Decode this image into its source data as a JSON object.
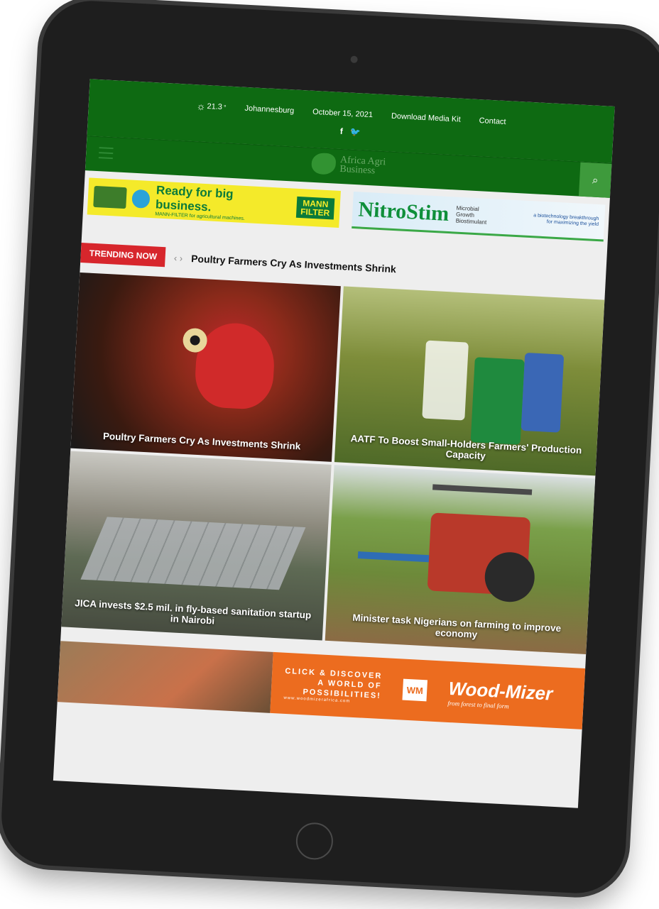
{
  "topbar": {
    "temperature": "21.3",
    "degree": "°",
    "city": "Johannesburg",
    "date": "October 15, 2021",
    "download_link": "Download Media Kit",
    "contact_link": "Contact",
    "social": {
      "facebook": "f",
      "twitter": "🐦"
    }
  },
  "logo": {
    "line1": "Africa Agri",
    "line2": "Business"
  },
  "ads": {
    "mann": {
      "headline": "Ready for big business.",
      "sub": "MANN-FILTER for agricultural machines.",
      "brand_top": "MANN",
      "brand_bottom": "FILTER"
    },
    "nitro": {
      "brand": "NitroStim",
      "desc_1": "Microbial",
      "desc_2": "Growth",
      "desc_3": "Biostimulant",
      "tag_1": "a biotechnology breakthrough",
      "tag_2": "for maximizing the yield"
    }
  },
  "trending": {
    "label": "TRENDING NOW",
    "arrows": "‹ ›",
    "title": "Poultry Farmers Cry As Investments Shrink"
  },
  "articles": [
    {
      "title": "Poultry Farmers Cry As Investments Shrink"
    },
    {
      "title": "AATF To Boost Small-Holders Farmers' Production Capacity"
    },
    {
      "title": "JICA invests $2.5 mil. in fly-based sanitation startup in Nairobi"
    },
    {
      "title": "Minister task Nigerians on farming to improve economy"
    }
  ],
  "wood_ad": {
    "cta_1": "CLICK & DISCOVER",
    "cta_2": "A WORLD OF",
    "cta_3": "POSSIBILITIES!",
    "url": "www.woodmizerafrica.com",
    "logo_mark": "WM",
    "brand": "Wood-Mizer",
    "tagline": "from forest to final form"
  },
  "colors": {
    "header_green": "#0e6a12",
    "trending_red": "#d7262c",
    "wood_orange": "#ec6c1f"
  }
}
